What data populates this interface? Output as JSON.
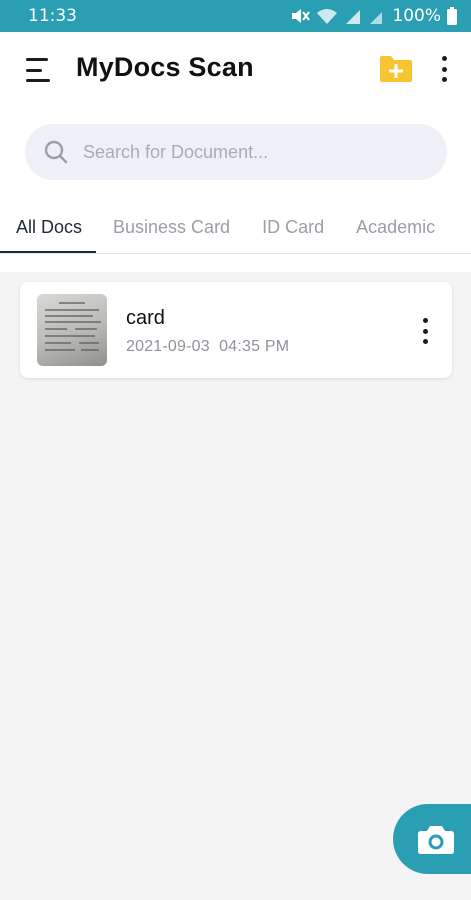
{
  "status_bar": {
    "time": "11:33",
    "battery": "100%",
    "icons": [
      "mute-icon",
      "wifi-icon",
      "signal-icon",
      "signal-icon",
      "battery-icon"
    ]
  },
  "header": {
    "title": "MyDocs Scan",
    "menu_icon": "hamburger-menu-icon",
    "add_folder_icon": "add-folder-icon",
    "more_icon": "more-vertical-icon"
  },
  "search": {
    "placeholder": "Search for Document...",
    "value": ""
  },
  "tabs": [
    {
      "label": "All Docs",
      "active": true
    },
    {
      "label": "Business Card",
      "active": false
    },
    {
      "label": "ID Card",
      "active": false
    },
    {
      "label": "Academic",
      "active": false
    }
  ],
  "documents": [
    {
      "name": "card",
      "date": "2021-09-03",
      "time": "04:35 PM"
    }
  ],
  "fab": {
    "icon": "camera-icon"
  },
  "colors": {
    "accent": "#2a9fb4",
    "folder": "#f7c531",
    "background": "#f4f4f5",
    "tab_indicator": "#1e2a44"
  }
}
